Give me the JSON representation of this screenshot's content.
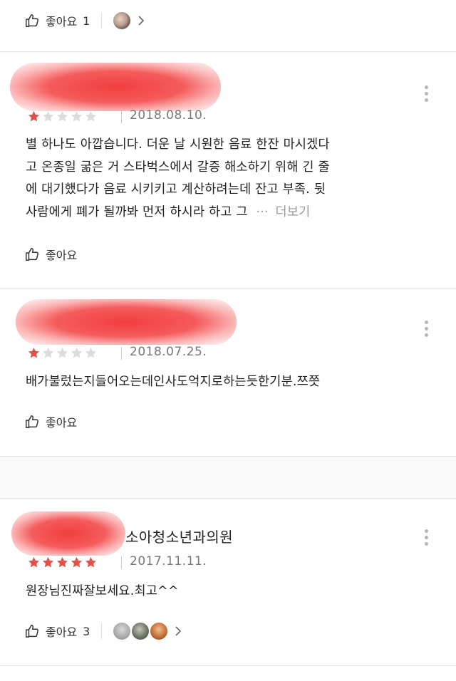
{
  "top_like": {
    "label": "좋아요",
    "count": "1"
  },
  "reviews": [
    {
      "rating": 1,
      "date": "2018.08.10.",
      "text_lines": [
        "별 하나도 아깝습니다. 더운 날 시원한 음료 한잔 마시겠다",
        "고 온종일 굶은 거 스타벅스에서 갈증 해소하기 위해 긴 줄",
        "에 대기했다가 음료 시키키고 계산하려는데 잔고 부족. 뒷",
        "사람에게 폐가 될까봐 먼저 하시라 하고 그"
      ],
      "ellipsis": "···",
      "more_label": "더보기",
      "like_label": "좋아요"
    },
    {
      "rating": 1,
      "date": "2018.07.25.",
      "text_lines": [
        "배가불렀는지들어오는데인사도억지로하는듯한기분.쯔쯧"
      ],
      "like_label": "좋아요"
    },
    {
      "rating": 5,
      "name_suffix": "소아청소년과의원",
      "date": "2017.11.11.",
      "text_lines": [
        "원장님진짜잘보세요.최고^^"
      ],
      "like_label": "좋아요",
      "like_count": "3"
    }
  ],
  "colors": {
    "star_on": "#e2504a",
    "star_off": "#dcdcdc",
    "redaction": "#f23f3f"
  },
  "icons": [
    "thumbs-up-icon",
    "chevron-right-icon",
    "more-vert-icon",
    "star-icon"
  ]
}
